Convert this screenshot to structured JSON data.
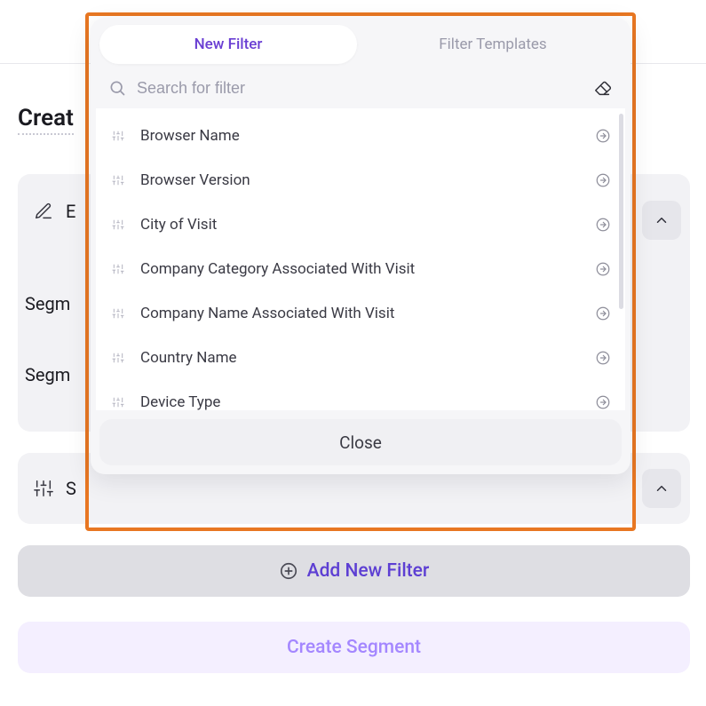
{
  "page": {
    "heading_truncated": "Creat",
    "edit_row_truncated": "E",
    "seg_label1": "Segm",
    "seg_label2": "Segm",
    "filters_row_truncated": "S"
  },
  "buttons": {
    "add_new_filter": "Add New Filter",
    "create_segment": "Create Segment"
  },
  "modal": {
    "tabs": {
      "new_filter": "New Filter",
      "filter_templates": "Filter Templates"
    },
    "search_placeholder": "Search for filter",
    "filters": [
      "Browser Name",
      "Browser Version",
      "City of Visit",
      "Company Category Associated With Visit",
      "Company Name Associated With Visit",
      "Country Name",
      "Device Type"
    ],
    "close_label": "Close"
  }
}
